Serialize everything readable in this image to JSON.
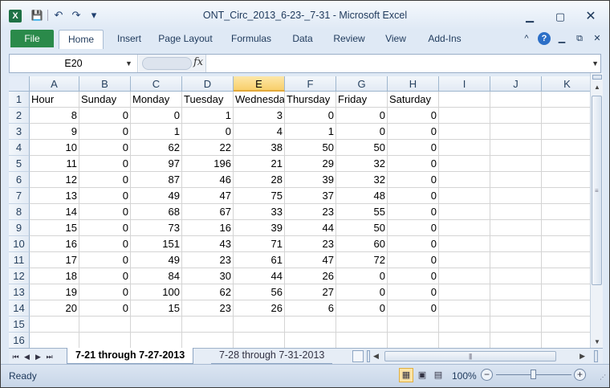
{
  "window": {
    "title": "ONT_Circ_2013_6-23-_7-31  -  Microsoft Excel",
    "app_icon": "X",
    "controls": {
      "minimize": "▁",
      "maximize": "▢",
      "close": "✕"
    }
  },
  "qat": {
    "save_icon": "💾",
    "undo_icon": "↶",
    "redo_icon": "↷",
    "customize_icon": "▾"
  },
  "ribbon": {
    "file_tab": "File",
    "tabs": [
      "Home",
      "Insert",
      "Page Layout",
      "Formulas",
      "Data",
      "Review",
      "View",
      "Add-Ins"
    ],
    "active_tab": "Home",
    "right_icons": {
      "minimize_ribbon": "^",
      "help": "?",
      "restore": "⧉",
      "close": "✕"
    }
  },
  "formula_bar": {
    "name_box": "E20",
    "fx_label": "fx",
    "formula": ""
  },
  "grid": {
    "columns": [
      "A",
      "B",
      "C",
      "D",
      "E",
      "F",
      "G",
      "H",
      "I",
      "J",
      "K"
    ],
    "selected_column": "E",
    "row_numbers": [
      "1",
      "2",
      "3",
      "4",
      "5",
      "6",
      "7",
      "8",
      "9",
      "10",
      "11",
      "12",
      "13",
      "14",
      "15",
      "16"
    ],
    "header_row": [
      "Hour",
      "Sunday",
      "Monday",
      "Tuesday",
      "Wednesday",
      "Thursday",
      "Friday",
      "Saturday"
    ],
    "data_rows": [
      [
        "8",
        "0",
        "0",
        "1",
        "3",
        "0",
        "0",
        "0"
      ],
      [
        "9",
        "0",
        "1",
        "0",
        "4",
        "1",
        "0",
        "0"
      ],
      [
        "10",
        "0",
        "62",
        "22",
        "38",
        "50",
        "50",
        "0"
      ],
      [
        "11",
        "0",
        "97",
        "196",
        "21",
        "29",
        "32",
        "0"
      ],
      [
        "12",
        "0",
        "87",
        "46",
        "28",
        "39",
        "32",
        "0"
      ],
      [
        "13",
        "0",
        "49",
        "47",
        "75",
        "37",
        "48",
        "0"
      ],
      [
        "14",
        "0",
        "68",
        "67",
        "33",
        "23",
        "55",
        "0"
      ],
      [
        "15",
        "0",
        "73",
        "16",
        "39",
        "44",
        "50",
        "0"
      ],
      [
        "16",
        "0",
        "151",
        "43",
        "71",
        "23",
        "60",
        "0"
      ],
      [
        "17",
        "0",
        "49",
        "23",
        "61",
        "47",
        "72",
        "0"
      ],
      [
        "18",
        "0",
        "84",
        "30",
        "44",
        "26",
        "0",
        "0"
      ],
      [
        "19",
        "0",
        "100",
        "62",
        "56",
        "27",
        "0",
        "0"
      ],
      [
        "20",
        "0",
        "15",
        "23",
        "26",
        "6",
        "0",
        "0"
      ]
    ]
  },
  "sheets": {
    "tabs": [
      "7-21 through 7-27-2013",
      "7-28 through 7-31-2013"
    ],
    "active": "7-21 through 7-27-2013",
    "nav_icons": [
      "⏮",
      "◀",
      "▶",
      "⏭"
    ]
  },
  "status": {
    "ready": "Ready",
    "zoom": "100%",
    "zoom_out": "−",
    "zoom_in": "+"
  }
}
